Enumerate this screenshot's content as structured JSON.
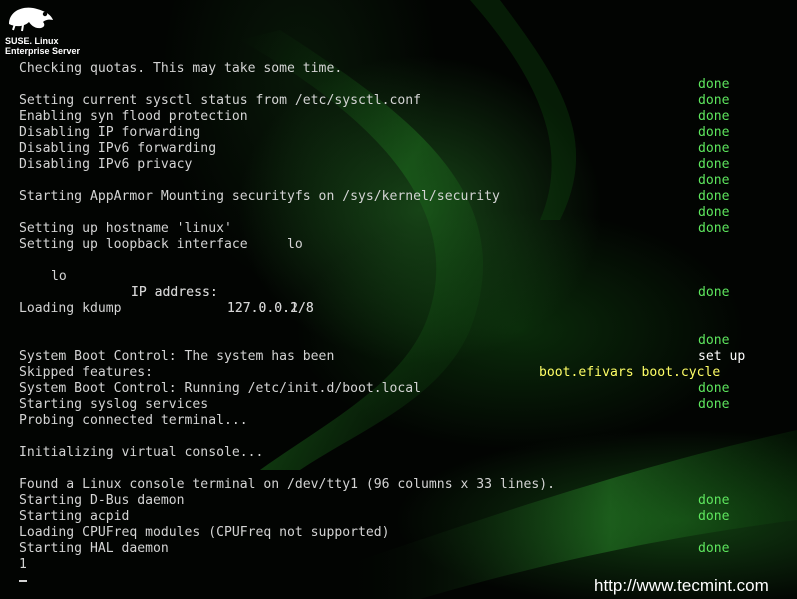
{
  "branding": {
    "line1": "SUSE. Linux",
    "line2": "Enterprise Server",
    "icon": "suse-chameleon-icon"
  },
  "lines": [
    {
      "msg": "Checking quotas. This may take some time.",
      "status": ""
    },
    {
      "msg": "",
      "status": "done"
    },
    {
      "msg": "Setting current sysctl status from /etc/sysctl.conf",
      "status": "done"
    },
    {
      "msg": "Enabling syn flood protection",
      "status": "done"
    },
    {
      "msg": "Disabling IP forwarding",
      "status": "done"
    },
    {
      "msg": "Disabling IPv6 forwarding",
      "status": "done"
    },
    {
      "msg": "Disabling IPv6 privacy",
      "status": "done"
    },
    {
      "msg": "",
      "status": "done"
    },
    {
      "msg": "Starting AppArmor Mounting securityfs on /sys/kernel/security",
      "status": "done"
    },
    {
      "msg": "",
      "status": "done"
    },
    {
      "msg": "Setting up hostname 'linux'",
      "status": "done"
    },
    {
      "msg": "Setting up loopback interface     lo",
      "status": ""
    },
    {
      "msg": "",
      "status": ""
    },
    {
      "msg": "",
      "status": ""
    },
    {
      "msg": "",
      "status": "done"
    },
    {
      "msg": "Loading kdump",
      "status": ""
    },
    {
      "msg": "",
      "status": ""
    },
    {
      "msg": "",
      "status": "done"
    },
    {
      "msg": "System Boot Control: The system has been",
      "status": "set up"
    },
    {
      "msg": "Skipped features:",
      "status": "boot.efivars boot.cycle"
    },
    {
      "msg": "System Boot Control: Running /etc/init.d/boot.local",
      "status": "done"
    },
    {
      "msg": "Starting syslog services",
      "status": "done"
    },
    {
      "msg": "Probing connected terminal...",
      "status": ""
    },
    {
      "msg": "",
      "status": ""
    },
    {
      "msg": "Initializing virtual console...",
      "status": ""
    },
    {
      "msg": "",
      "status": ""
    },
    {
      "msg": "Found a Linux console terminal on /dev/tty1 (96 columns x 33 lines).",
      "status": ""
    },
    {
      "msg": "Starting D-Bus daemon",
      "status": "done"
    },
    {
      "msg": "Starting acpid",
      "status": "done"
    },
    {
      "msg": "Loading CPUFreq modules (CPUFreq not supported)",
      "status": ""
    },
    {
      "msg": "Starting HAL daemon",
      "status": "done"
    },
    {
      "msg": "1",
      "status": ""
    }
  ],
  "ip": {
    "iface": "lo",
    "addr1_label": "IP address:",
    "addr1": "127.0.0.1/8",
    "addr2_label": "IP address:",
    "addr2": "127.0.0.2/8"
  },
  "watermark": "http://www.tecmint.com",
  "colors": {
    "done": "#5ee65e",
    "skipped": "#ffff66",
    "text": "#d4d4d4"
  }
}
